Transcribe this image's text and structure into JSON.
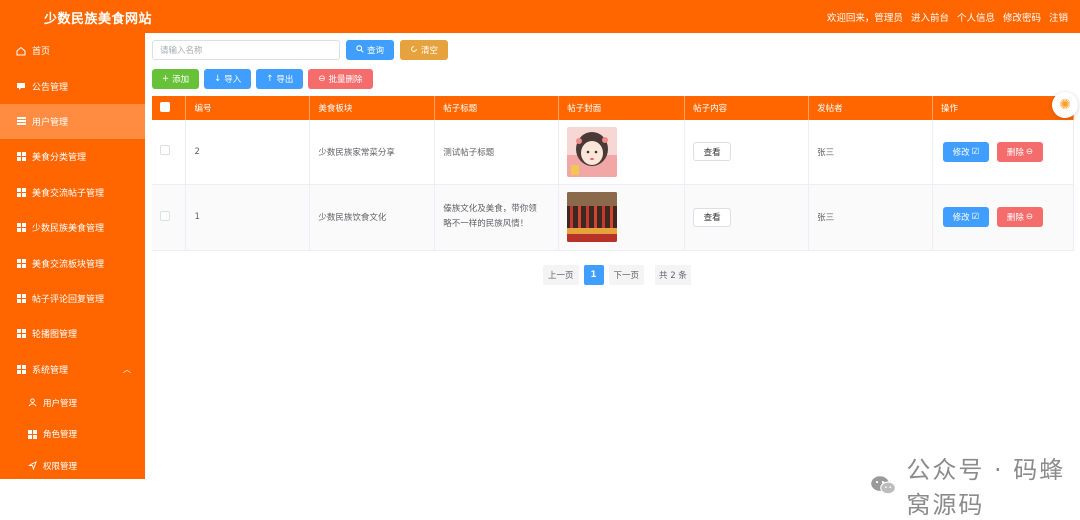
{
  "app": {
    "title": "少数民族美食网站"
  },
  "topbar": {
    "links": [
      "欢迎回来，管理员",
      "进入前台",
      "个人信息",
      "修改密码",
      "注销"
    ]
  },
  "sidebar": {
    "items": [
      {
        "label": "首页",
        "icon": "home-icon"
      },
      {
        "label": "公告管理",
        "icon": "message-icon"
      },
      {
        "label": "用户管理",
        "icon": "list-icon",
        "active": true
      },
      {
        "label": "美食分类管理",
        "icon": "grid-icon"
      },
      {
        "label": "美食交流帖子管理",
        "icon": "grid-icon"
      },
      {
        "label": "少数民族美食管理",
        "icon": "grid-icon"
      },
      {
        "label": "美食交流板块管理",
        "icon": "grid-icon"
      },
      {
        "label": "帖子评论回复管理",
        "icon": "grid-icon"
      },
      {
        "label": "轮播图管理",
        "icon": "grid-icon"
      },
      {
        "label": "系统管理",
        "icon": "apps-icon",
        "expanded": true
      }
    ],
    "sub_items": [
      {
        "label": "用户管理",
        "icon": "user-icon"
      },
      {
        "label": "角色管理",
        "icon": "grid-icon"
      },
      {
        "label": "权限管理",
        "icon": "send-icon"
      }
    ]
  },
  "search": {
    "placeholder": "请输入名称",
    "query_label": "查询",
    "clear_label": "清空"
  },
  "actions": {
    "add": "添加",
    "import": "导入",
    "export": "导出",
    "batch_delete": "批量删除"
  },
  "table": {
    "columns": [
      "编号",
      "美食板块",
      "帖子标题",
      "帖子封面",
      "帖子内容",
      "发帖者",
      "操作"
    ],
    "rows": [
      {
        "id": "2",
        "section": "少数民族家常菜分享",
        "title": "测试帖子标题",
        "cover": "girl-avatar",
        "content_btn": "查看",
        "author": "张三",
        "edit": "修改",
        "delete": "删除"
      },
      {
        "id": "1",
        "section": "少数民族饮食文化",
        "title": "傣族文化及美食，带你领略不一样的民族风情！",
        "cover": "festival-photo",
        "content_btn": "查看",
        "author": "张三",
        "edit": "修改",
        "delete": "删除"
      }
    ]
  },
  "pagination": {
    "prev": "上一页",
    "current": "1",
    "next": "下一页",
    "total": "共 2 条"
  },
  "watermark": {
    "text": "公众号 · 码蜂窝源码"
  },
  "colors": {
    "brand": "#ff6600",
    "primary": "#409eff",
    "warning": "#e6a23c",
    "success": "#67c23a",
    "danger": "#f56c6c"
  }
}
